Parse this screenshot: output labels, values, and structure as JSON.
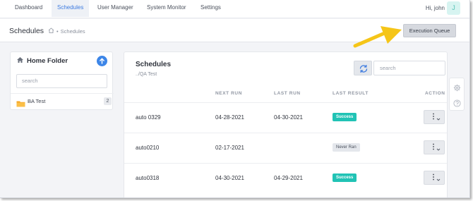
{
  "nav": {
    "items": [
      {
        "label": "Dashboard"
      },
      {
        "label": "Schedules"
      },
      {
        "label": "User Manager"
      },
      {
        "label": "System Monitor"
      },
      {
        "label": "Settings"
      }
    ],
    "greeting": "Hi, john",
    "avatar_initial": "J"
  },
  "header": {
    "title": "Schedules",
    "breadcrumb": "Schedules",
    "execution_queue_label": "Execution Queue"
  },
  "folder_panel": {
    "title": "Home Folder",
    "search_placeholder": "search",
    "folders": [
      {
        "name": "BA Test",
        "count": "2"
      }
    ]
  },
  "schedules": {
    "title": "Schedules",
    "path": "../QA Test",
    "search_placeholder": "search",
    "columns": [
      "NEXT RUN",
      "LAST RUN",
      "LAST RESULT",
      "ACTION"
    ],
    "rows": [
      {
        "name": "auto 0329",
        "next_run": "04-28-2021",
        "last_run": "04-30-2021",
        "last_result": "Success"
      },
      {
        "name": "auto0210",
        "next_run": "02-17-2021",
        "last_run": "",
        "last_result": "Never Ran"
      },
      {
        "name": "auto0318",
        "next_run": "04-30-2021",
        "last_run": "04-29-2021",
        "last_result": "Success"
      }
    ]
  },
  "colors": {
    "accent": "#3d7be0",
    "success": "#21c3b5",
    "arrow": "#f5c518"
  },
  "icons": [
    "home-icon",
    "arrow-up-icon",
    "folder-icon",
    "refresh-icon",
    "more-vertical-icon",
    "chevron-down-icon",
    "settings-icon",
    "help-icon"
  ]
}
